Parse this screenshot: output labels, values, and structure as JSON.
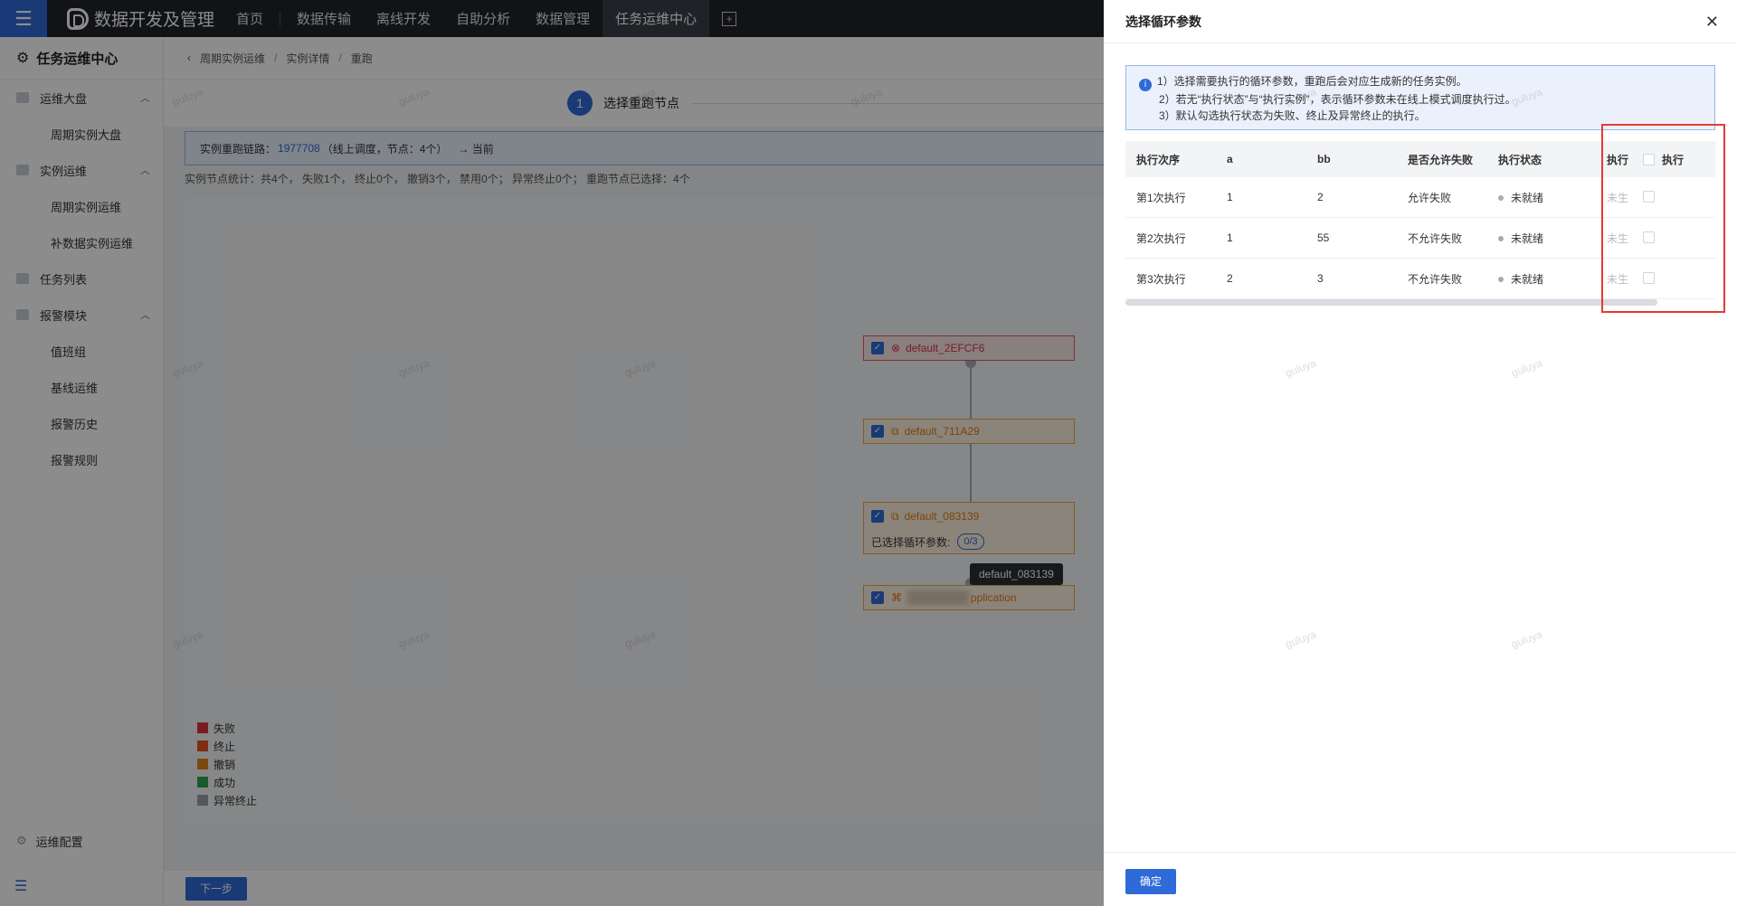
{
  "topbar": {
    "brand": "数据开发及管理",
    "nav": [
      "首页",
      "数据传输",
      "离线开发",
      "自助分析",
      "数据管理",
      "任务运维中心"
    ]
  },
  "sidebar": {
    "title": "任务运维中心",
    "groups": [
      {
        "label": "运维大盘",
        "subs": [
          "周期实例大盘"
        ]
      },
      {
        "label": "实例运维",
        "subs": [
          "周期实例运维",
          "补数据实例运维"
        ]
      },
      {
        "label": "任务列表",
        "subs": []
      },
      {
        "label": "报警模块",
        "subs": [
          "值班组",
          "基线运维",
          "报警历史",
          "报警规则"
        ]
      }
    ],
    "footer": "运维配置"
  },
  "breadcrumb": [
    "周期实例运维",
    "实例详情",
    "重跑"
  ],
  "step": {
    "num": "1",
    "label": "选择重跑节点"
  },
  "chain": {
    "prefix": "实例重跑链路：",
    "id": "1977708",
    "suffix": "（线上调度，节点：4个）",
    "arrow": "→ 当前"
  },
  "stats": "实例节点统计：共4个， 失败1个， 终止0个， 撤销3个， 禁用0个； 异常终止0个； 重跑节点已选择：4个",
  "nodes": {
    "n1": "default_2EFCF6",
    "n2": "default_711A29",
    "n3": "default_083139",
    "n3_loop": "已选择循环参数:",
    "n3_badge": "0/3",
    "n4": "pplication"
  },
  "tooltip": "default_083139",
  "legend": [
    {
      "label": "失败",
      "color": "#d9363e"
    },
    {
      "label": "终止",
      "color": "#e8541f"
    },
    {
      "label": "撤销",
      "color": "#e0861a"
    },
    {
      "label": "成功",
      "color": "#2ea84f"
    },
    {
      "label": "异常终止",
      "color": "#9aa0a8"
    }
  ],
  "next_btn": "下一步",
  "watermark": "guluya",
  "drawer": {
    "title": "选择循环参数",
    "info": [
      "1）选择需要执行的循环参数，重跑后会对应生成新的任务实例。",
      "2）若无“执行状态”与“执行实例”，表示循环参数未在线上模式调度执行过。",
      "3）默认勾选执行状态为失败、终止及异常终止的执行。"
    ],
    "headers": [
      "执行次序",
      "a",
      "bb",
      "是否允许失败",
      "执行状态",
      "执行",
      "执行"
    ],
    "rows": [
      [
        "第1次执行",
        "1",
        "2",
        "允许失败",
        "未就绪",
        "未生"
      ],
      [
        "第2次执行",
        "1",
        "55",
        "不允许失败",
        "未就绪",
        "未生"
      ],
      [
        "第3次执行",
        "2",
        "3",
        "不允许失败",
        "未就绪",
        "未生"
      ]
    ],
    "ok": "确定"
  }
}
